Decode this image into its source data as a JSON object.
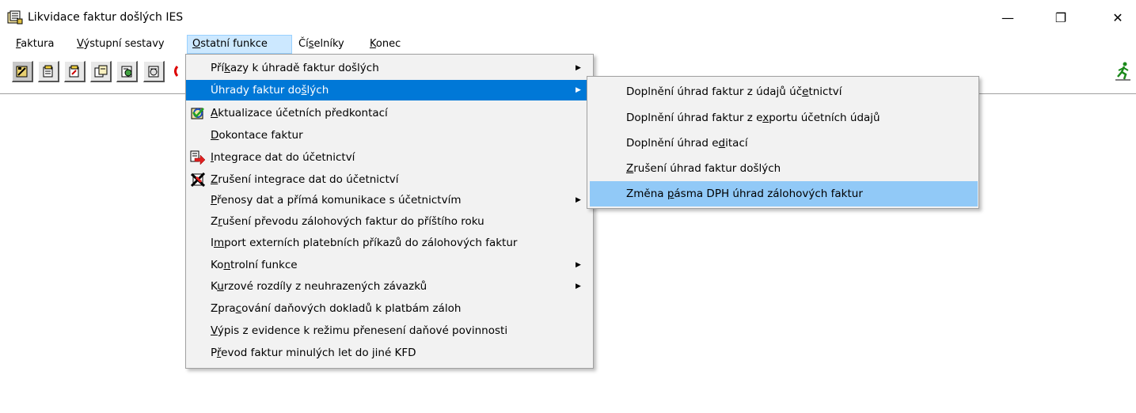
{
  "window": {
    "title": "Likvidace faktur došlých  IES",
    "min_glyph": "—",
    "max_glyph": "❐",
    "close_glyph": "✕"
  },
  "menubar": {
    "items": [
      {
        "first": "F",
        "rest": "aktura"
      },
      {
        "first": "V",
        "rest": "ýstupní sestavy"
      },
      {
        "first": "O",
        "rest": "statní funkce"
      },
      {
        "pre": "Čí",
        "u": "s",
        "rest": "elníky"
      },
      {
        "first": "K",
        "rest": "onec"
      }
    ]
  },
  "toolbar": {
    "buttons": [
      "tool-1-icon",
      "tool-2-icon",
      "tool-3-icon",
      "tool-4-icon",
      "tool-5-icon"
    ],
    "exit_icon": "running-man-exit-icon"
  },
  "dropdown": {
    "items": [
      {
        "pre": "Pří",
        "u": "k",
        "post": "azy k úhradě faktur došlých",
        "submenu": true
      },
      {
        "pre": "Úhrady faktur do",
        "u": "š",
        "post": "lých",
        "submenu": true,
        "highlighted": true
      },
      {
        "pre": "",
        "u": "A",
        "post": "ktualizace účetních předkontací",
        "icon": "refresh-check-icon"
      },
      {
        "pre": "",
        "u": "D",
        "post": "okontace faktur"
      },
      {
        "pre": "",
        "u": "I",
        "post": "ntegrace dat do účetnictví",
        "icon": "red-arrow-integrate-icon"
      },
      {
        "pre": "",
        "u": "Z",
        "post": "rušení integrace dat do účetnictví",
        "icon": "cancel-x-icon"
      },
      {
        "pre": "",
        "u": "P",
        "post": "řenosy dat a přímá komunikace s účetnictvím",
        "submenu": true
      },
      {
        "pre": "Z",
        "u": "r",
        "post": "ušení převodu zálohových faktur do příštího roku"
      },
      {
        "pre": "I",
        "u": "m",
        "post": "port externích platebních příkazů do zálohových faktur"
      },
      {
        "pre": "Ko",
        "u": "n",
        "post": "trolní funkce",
        "submenu": true
      },
      {
        "pre": "K",
        "u": "u",
        "post": "rzové rozdíly z neuhrazených závazků",
        "submenu": true
      },
      {
        "pre": "Zpra",
        "u": "c",
        "post": "ování daňových dokladů k platbám záloh"
      },
      {
        "pre": "",
        "u": "V",
        "post": "ýpis z evidence k režimu přenesení daňové povinnosti"
      },
      {
        "pre": "P",
        "u": "ř",
        "post": "evod faktur minulých let do jiné KFD"
      }
    ],
    "arrow_glyph": "▶"
  },
  "submenu": {
    "items": [
      {
        "pre": "Doplnění úhrad faktur z údajů úč",
        "u": "e",
        "post": "tnictví"
      },
      {
        "pre": "Doplnění úhrad faktur z e",
        "u": "x",
        "post": "portu účetních údajů"
      },
      {
        "pre": "Doplnění úhrad e",
        "u": "d",
        "post": "itací"
      },
      {
        "pre": "",
        "u": "Z",
        "post": "rušení úhrad faktur došlých"
      },
      {
        "pre": "Změna ",
        "u": "p",
        "post": "ásma DPH úhrad zálohových faktur",
        "highlighted": true
      }
    ]
  }
}
